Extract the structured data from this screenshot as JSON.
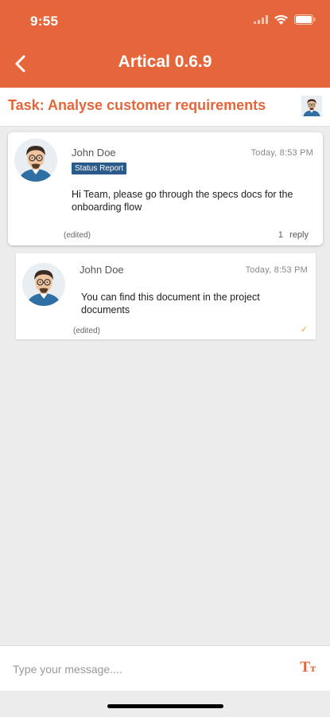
{
  "status_bar": {
    "time": "9:55"
  },
  "header": {
    "title": "Artical 0.6.9",
    "accent": "#e4663a"
  },
  "task": {
    "title": "Task: Analyse customer requirements"
  },
  "messages": [
    {
      "author": "John Doe",
      "timestamp": "Today,  8:53 PM",
      "badge": "Status Report",
      "text": "Hi Team, please go through the specs docs for the onboarding flow",
      "edited": "(edited)",
      "reply_count": "1",
      "reply_label": "reply"
    },
    {
      "author": "John Doe",
      "timestamp": "Today,  8:53 PM",
      "text": "You can find this document in the project documents",
      "edited": "(edited)",
      "status": "✓"
    }
  ],
  "composer": {
    "placeholder": "Type your message....",
    "format_icon": "Tт"
  }
}
